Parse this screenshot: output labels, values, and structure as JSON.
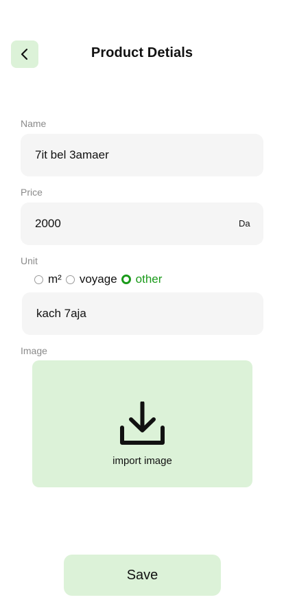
{
  "header": {
    "title": "Product Detials",
    "back_icon": "chevron-left-icon"
  },
  "form": {
    "name": {
      "label": "Name",
      "value": "7it bel 3amaer"
    },
    "price": {
      "label": "Price",
      "value": "2000",
      "suffix": "Da"
    },
    "unit": {
      "label": "Unit",
      "options": [
        {
          "label": "m²",
          "selected": false
        },
        {
          "label": "voyage",
          "selected": false
        },
        {
          "label": "other",
          "selected": true
        }
      ],
      "custom_value": "kach 7aja"
    },
    "image": {
      "label": "Image",
      "upload_text": "import image",
      "upload_icon": "download-icon"
    }
  },
  "actions": {
    "save_label": "Save"
  },
  "colors": {
    "accent_bg": "#dcf2d8",
    "selected_green": "#1a9a1a",
    "field_bg": "#f5f5f5"
  }
}
